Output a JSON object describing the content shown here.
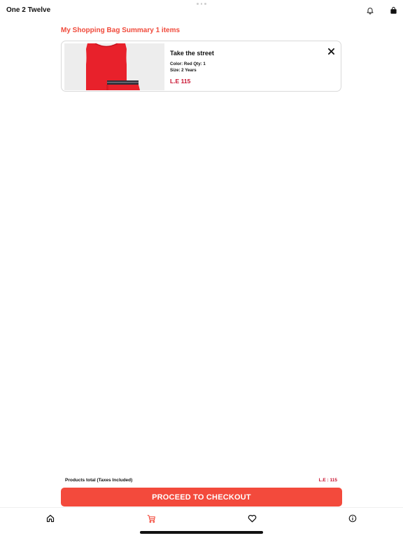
{
  "app": {
    "title": "One 2 Twelve",
    "accent_color": "#f34a3c",
    "price_color": "#c8102e"
  },
  "header": {
    "icons": [
      "bell-icon",
      "shopping-bag-icon"
    ]
  },
  "summary": {
    "title": "My Shopping Bag Summary 1 items"
  },
  "cart": {
    "items": [
      {
        "name": "Take the street",
        "details": "Color: Red  Qty: 1",
        "size": "Size: 2 Years",
        "price": "L.E 115",
        "image": "red-sleeveless-top-and-shorts-set",
        "product_color": "#e8212b"
      }
    ]
  },
  "totals": {
    "label": "Products total (Taxes Included)",
    "value": "L.E : 115"
  },
  "checkout": {
    "label": "PROCEED TO CHECKOUT"
  },
  "tabbar": {
    "tabs": [
      {
        "name": "home",
        "icon": "home-icon",
        "active": false
      },
      {
        "name": "cart",
        "icon": "cart-icon",
        "active": true
      },
      {
        "name": "wishlist",
        "icon": "heart-icon",
        "active": false
      },
      {
        "name": "info",
        "icon": "info-icon",
        "active": false
      }
    ]
  }
}
